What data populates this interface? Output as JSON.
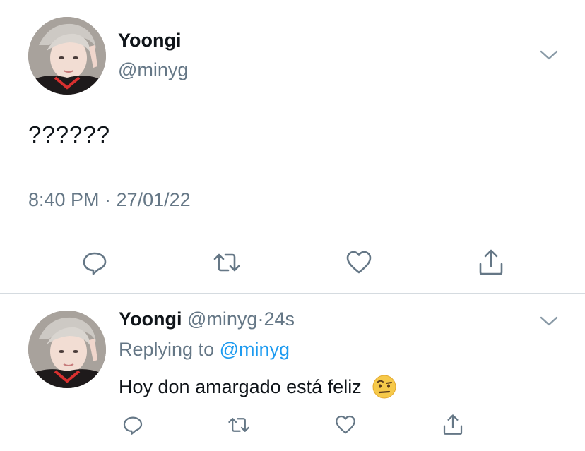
{
  "main_tweet": {
    "author_name": "Yoongi",
    "author_handle": "@minyg",
    "text": "??????",
    "timestamp": "8:40 PM · 27/01/22"
  },
  "reply": {
    "author_name": "Yoongi",
    "author_handle": "@minyg",
    "time": "24s",
    "replying_prefix": "Replying to",
    "replying_to": "@minyg",
    "text": "Hoy don amargado está feliz",
    "emoji": "face-with-raised-eyebrow"
  },
  "actions": [
    "reply-icon",
    "retweet-icon",
    "like-icon",
    "share-icon"
  ],
  "colors": {
    "text_primary": "#0f1419",
    "text_secondary": "#657786",
    "link": "#1d9bf0",
    "divider": "#d5dbe0",
    "icon": "#657786"
  }
}
